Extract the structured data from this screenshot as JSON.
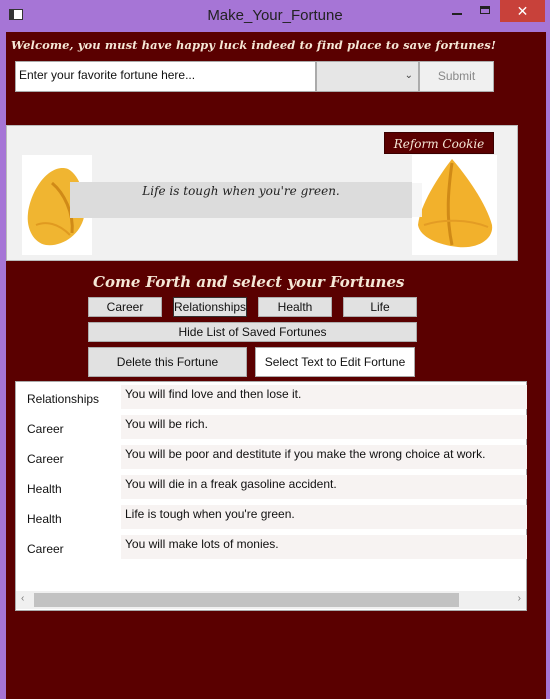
{
  "window": {
    "title": "Make_Your_Fortune",
    "close_glyph": "✕"
  },
  "welcome": "Welcome, you must have happy luck indeed to find place to save fortunes!",
  "input": {
    "placeholder": "Enter your favorite fortune here..."
  },
  "category_select": {
    "value": ""
  },
  "submit_label": "Submit",
  "reform_label": "Reform Cookie",
  "current_fortune": "Life is tough when you're green.",
  "heading": "Come Forth and select your Fortunes",
  "categories": [
    "Career",
    "Relationships",
    "Health",
    "Life"
  ],
  "hide_label": "Hide List of Saved Fortunes",
  "delete_label": "Delete this Fortune",
  "edit_label": "Select Text to Edit Fortune",
  "saved": [
    {
      "category": "Relationships",
      "text": "You will find love and then lose it."
    },
    {
      "category": "Career",
      "text": "You will be rich."
    },
    {
      "category": "Career",
      "text": "You will be poor and destitute if you make the wrong choice at work."
    },
    {
      "category": "Health",
      "text": "You will die in a freak gasoline accident."
    },
    {
      "category": "Health",
      "text": "Life is tough when you're green."
    },
    {
      "category": "Career",
      "text": "You will make lots of monies."
    }
  ],
  "icons": {
    "left_arrow": "‹",
    "right_arrow": "›",
    "dropdown": "⌄"
  },
  "colors": {
    "background": "#5a0000",
    "chrome": "#a675d6",
    "close": "#c8413a",
    "text_light": "#f5e7d6"
  }
}
